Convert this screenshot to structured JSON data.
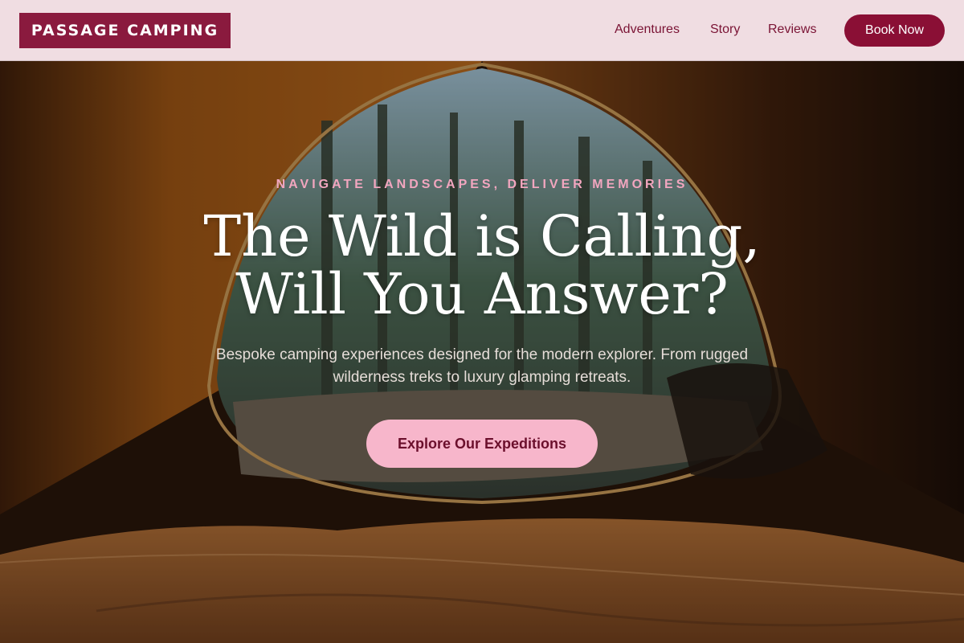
{
  "brand": {
    "name": "PASSAGE CAMPING"
  },
  "nav": {
    "links": [
      "Adventures",
      "Story",
      "Reviews"
    ],
    "cta_label": "Book Now"
  },
  "hero": {
    "eyebrow": "NAVIGATE LANDSCAPES, DELIVER MEMORIES",
    "headline_line1": "The Wild is Calling,",
    "headline_line2": "Will You Answer?",
    "subtext": "Bespoke camping experiences designed for the modern explorer. From rugged wilderness treks to luxury glamping retreats.",
    "cta_label": "Explore Our Expeditions",
    "background": "photo of forest view from inside an orange tent"
  },
  "colors": {
    "brand": "#8a1a3e",
    "nav_bg": "#f0dde2",
    "book_button": "#8a0f35",
    "cta_button": "#f7b6cb",
    "eyebrow": "#f2a6bf"
  }
}
